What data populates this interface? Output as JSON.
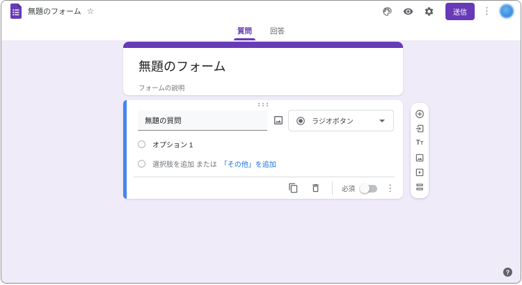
{
  "header": {
    "form_title": "無題のフォーム",
    "send_label": "送信"
  },
  "tabs": {
    "questions": "質問",
    "answers": "回答"
  },
  "title_card": {
    "title": "無題のフォーム",
    "description": "フォームの説明"
  },
  "question": {
    "title": "無題の質問",
    "type": "ラジオボタン",
    "option1": "オプション 1",
    "add_option_text": "選択肢を追加 または",
    "add_other_link": "「その他」を追加",
    "required_label": "必須"
  },
  "icons": {
    "star": "☆",
    "kebab": "⋮",
    "help": "?",
    "add_title_main": "T",
    "add_title_small": "T"
  },
  "side_toolbar_items": [
    {
      "name": "add-question"
    },
    {
      "name": "import-questions"
    },
    {
      "name": "add-title-and-description"
    },
    {
      "name": "add-image"
    },
    {
      "name": "add-video"
    },
    {
      "name": "add-section"
    }
  ],
  "colors": {
    "brand_purple": "#673ab7",
    "selected_blue": "#4285f4",
    "link_blue": "#1a73e8",
    "background_lavender": "#f0ebf8"
  }
}
